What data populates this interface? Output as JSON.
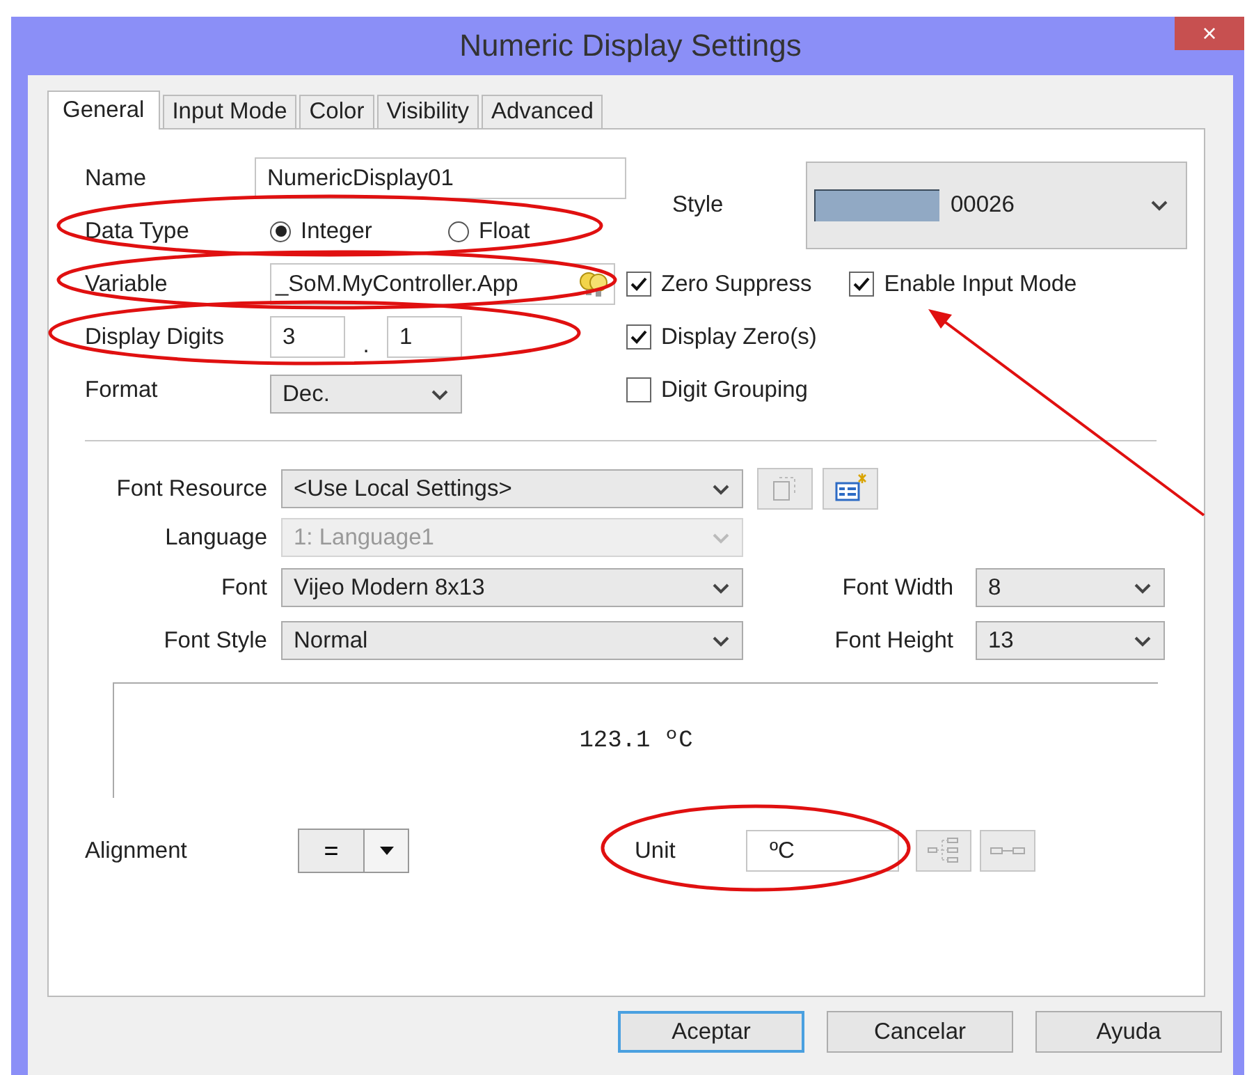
{
  "window": {
    "title": "Numeric Display Settings",
    "close": "×"
  },
  "tabs": [
    {
      "label": "General",
      "selected": true
    },
    {
      "label": "Input Mode",
      "selected": false
    },
    {
      "label": "Color",
      "selected": false
    },
    {
      "label": "Visibility",
      "selected": false
    },
    {
      "label": "Advanced",
      "selected": false
    }
  ],
  "name": {
    "label": "Name",
    "value": "NumericDisplay01"
  },
  "style": {
    "label": "Style",
    "value": "00026"
  },
  "data_type": {
    "label": "Data Type",
    "options": [
      {
        "label": "Integer",
        "selected": true
      },
      {
        "label": "Float",
        "selected": false
      }
    ]
  },
  "variable": {
    "label": "Variable",
    "value": "_SoM.MyController.App"
  },
  "display_digits": {
    "label": "Display Digits",
    "integer": "3",
    "separator": ".",
    "decimal": "1"
  },
  "format": {
    "label": "Format",
    "value": "Dec."
  },
  "checkboxes": [
    {
      "label": "Zero Suppress",
      "checked": true
    },
    {
      "label": "Enable Input Mode",
      "checked": true
    },
    {
      "label": "Display Zero(s)",
      "checked": true
    },
    {
      "label": "Digit Grouping",
      "checked": false
    }
  ],
  "font_resource": {
    "label": "Font Resource",
    "value": "<Use Local Settings>"
  },
  "language": {
    "label": "Language",
    "value": "1: Language1",
    "disabled": true
  },
  "font": {
    "label": "Font",
    "value": "Vijeo Modern 8x13"
  },
  "font_width": {
    "label": "Font Width",
    "value": "8"
  },
  "font_style": {
    "label": "Font Style",
    "value": "Normal"
  },
  "font_height": {
    "label": "Font Height",
    "value": "13"
  },
  "preview": {
    "text": "123.1 ºC"
  },
  "alignment": {
    "label": "Alignment",
    "symbol": "="
  },
  "unit": {
    "label": "Unit",
    "value": "ºC"
  },
  "buttons": [
    {
      "label": "Aceptar",
      "focused": true
    },
    {
      "label": "Cancelar",
      "focused": false
    },
    {
      "label": "Ayuda",
      "focused": false
    }
  ]
}
